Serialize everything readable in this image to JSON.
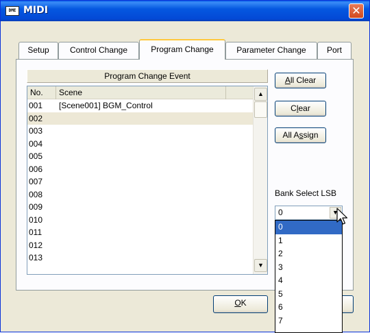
{
  "window": {
    "title": "MIDI",
    "icon_text": "DME"
  },
  "tabs": [
    {
      "label": "Setup",
      "active": false
    },
    {
      "label": "Control Change",
      "active": false
    },
    {
      "label": "Program Change",
      "active": true
    },
    {
      "label": "Parameter Change",
      "active": false
    },
    {
      "label": "Port",
      "active": false
    }
  ],
  "list": {
    "group_title": "Program Change Event",
    "columns": [
      "No.",
      "Scene"
    ],
    "rows": [
      {
        "no": "001",
        "scene": "[Scene001] BGM_Control"
      },
      {
        "no": "002",
        "scene": ""
      },
      {
        "no": "003",
        "scene": ""
      },
      {
        "no": "004",
        "scene": ""
      },
      {
        "no": "005",
        "scene": ""
      },
      {
        "no": "006",
        "scene": ""
      },
      {
        "no": "007",
        "scene": ""
      },
      {
        "no": "008",
        "scene": ""
      },
      {
        "no": "009",
        "scene": ""
      },
      {
        "no": "010",
        "scene": ""
      },
      {
        "no": "011",
        "scene": ""
      },
      {
        "no": "012",
        "scene": ""
      },
      {
        "no": "013",
        "scene": ""
      }
    ],
    "selected_row": "002"
  },
  "buttons": {
    "all_clear": {
      "pre": "",
      "u": "A",
      "post": "ll Clear"
    },
    "clear": {
      "pre": "C",
      "u": "l",
      "post": "ear"
    },
    "all_assign": {
      "pre": "All A",
      "u": "s",
      "post": "sign"
    },
    "ok": {
      "pre": "",
      "u": "O",
      "post": "K"
    }
  },
  "bank_select": {
    "label": "Bank Select LSB",
    "value": "0",
    "options": [
      "0",
      "1",
      "2",
      "3",
      "4",
      "5",
      "6",
      "7"
    ],
    "highlighted": "0"
  },
  "colors": {
    "titlebar": "#0558e0",
    "tab_accent": "#ffc83c",
    "highlight": "#316ac5",
    "selected_row": "#ede8d6"
  }
}
